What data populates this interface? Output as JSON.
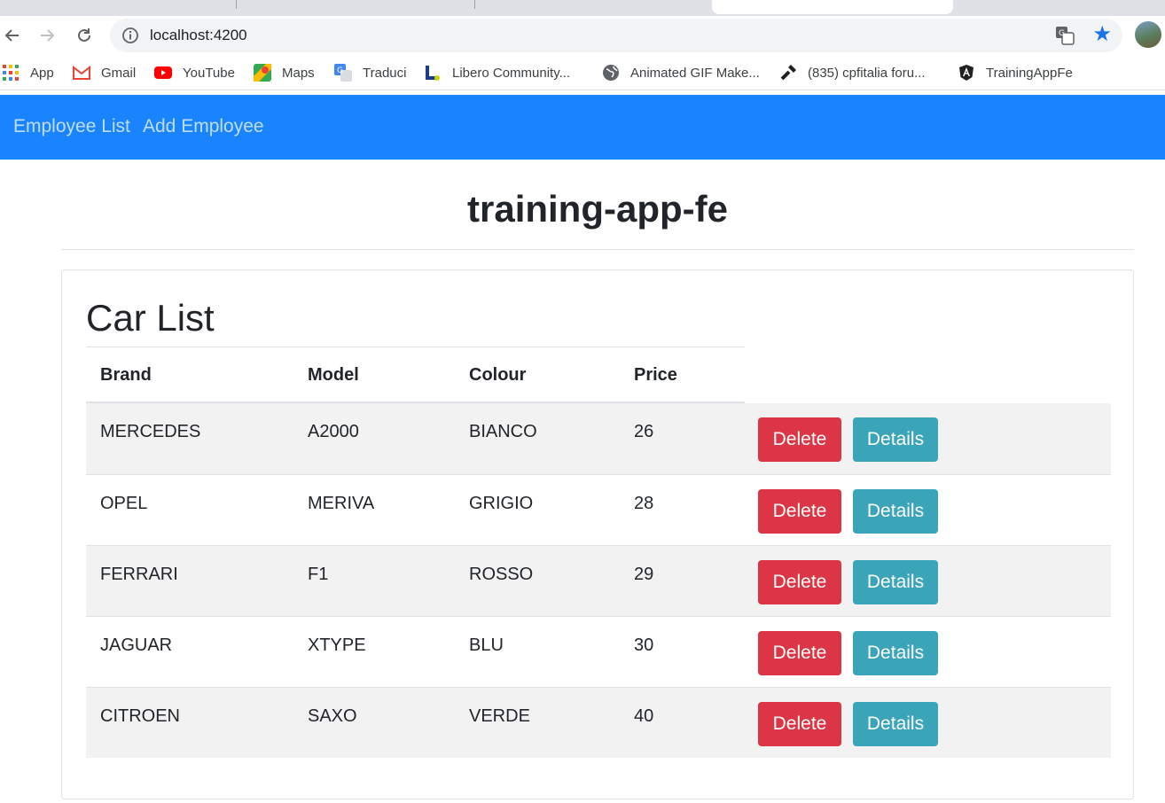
{
  "browser": {
    "url": "localhost:4200",
    "bookmarks": [
      {
        "label": "App",
        "icon": "apps-grid-icon"
      },
      {
        "label": "Gmail",
        "icon": "gmail-icon"
      },
      {
        "label": "YouTube",
        "icon": "youtube-icon"
      },
      {
        "label": "Maps",
        "icon": "maps-icon"
      },
      {
        "label": "Traduci",
        "icon": "translate-icon"
      },
      {
        "label": "Libero Community...",
        "icon": "libero-icon"
      },
      {
        "label": "Animated GIF Make...",
        "icon": "globe-icon"
      },
      {
        "label": "(835) cpfitalia foru...",
        "icon": "flashlight-icon"
      },
      {
        "label": "TrainingAppFe",
        "icon": "angular-icon"
      }
    ]
  },
  "nav": {
    "employee_list": "Employee List",
    "add_employee": "Add Employee"
  },
  "page": {
    "title": "training-app-fe"
  },
  "car_list": {
    "heading": "Car List",
    "columns": [
      "Brand",
      "Model",
      "Colour",
      "Price"
    ],
    "rows": [
      {
        "brand": "MERCEDES",
        "model": "A2000",
        "colour": "BIANCO",
        "price": "26",
        "delete": "Delete",
        "details": "Details"
      },
      {
        "brand": "OPEL",
        "model": "MERIVA",
        "colour": "GRIGIO",
        "price": "28",
        "delete": "Delete",
        "details": "Details"
      },
      {
        "brand": "FERRARI",
        "model": "F1",
        "colour": "ROSSO",
        "price": "29",
        "delete": "Delete",
        "details": "Details"
      },
      {
        "brand": "JAGUAR",
        "model": "XTYPE",
        "colour": "BLU",
        "price": "30",
        "delete": "Delete",
        "details": "Details"
      },
      {
        "brand": "CITROEN",
        "model": "SAXO",
        "colour": "VERDE",
        "price": "40",
        "delete": "Delete",
        "details": "Details"
      }
    ]
  },
  "colors": {
    "navbar": "#1a84ff",
    "delete_button": "#dc3545",
    "details_button": "#3aa5b8",
    "striped_row": "#f2f2f2"
  }
}
